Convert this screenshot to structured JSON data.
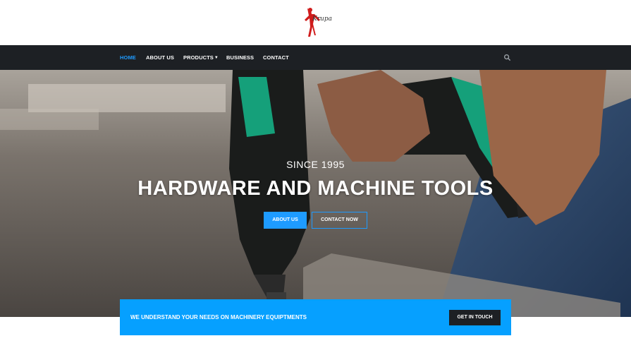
{
  "logo": {
    "text": "Krupa"
  },
  "nav": {
    "items": [
      {
        "label": "HOME"
      },
      {
        "label": "ABOUT US"
      },
      {
        "label": "PRODUCTS"
      },
      {
        "label": "BUSINESS"
      },
      {
        "label": "CONTACT"
      }
    ],
    "active_color": "#1e9bff"
  },
  "hero": {
    "since": "SINCE 1995",
    "title": "HARDWARE AND MACHINE TOOLS",
    "about_label": "ABOUT US",
    "contact_label": "CONTACT NOW"
  },
  "cta": {
    "text": "WE UNDERSTAND YOUR NEEDS ON MACHINERY EQUIPTMENTS",
    "button_label": "GET IN TOUCH",
    "color": "#06a0ff"
  },
  "icons": {
    "search": "search-icon",
    "chevron": "chevron-down-icon",
    "logo": "brand-logo"
  }
}
